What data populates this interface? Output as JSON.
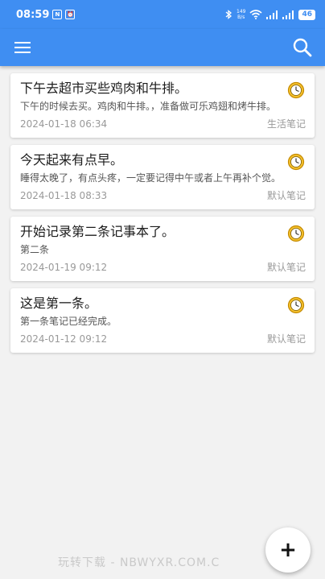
{
  "status_bar": {
    "time": "08:59",
    "network_speed_value": "149",
    "network_speed_unit": "B/s",
    "battery_level": "46",
    "icons": [
      "notification-n-icon",
      "notification-alarm-icon",
      "bluetooth-icon",
      "wifi-icon",
      "signal-icon",
      "signal-icon-2",
      "battery-icon"
    ]
  },
  "app_bar": {
    "menu_icon": "hamburger-menu-icon",
    "search_icon": "search-icon",
    "color": "#3f8ef2"
  },
  "notes": [
    {
      "title": "下午去超市买些鸡肉和牛排。",
      "body": "下午的时候去买。鸡肉和牛排。，准备做可乐鸡翅和烤牛排。",
      "date": "2024-01-18 06:34",
      "category": "生活笔记",
      "icon": "clock-icon"
    },
    {
      "title": "今天起来有点早。",
      "body": "睡得太晚了，有点头疼，一定要记得中午或者上午再补个觉。",
      "date": "2024-01-18 08:33",
      "category": "默认笔记",
      "icon": "clock-icon"
    },
    {
      "title": "开始记录第二条记事本了。",
      "body": "第二条",
      "date": "2024-01-19 09:12",
      "category": "默认笔记",
      "icon": "clock-icon"
    },
    {
      "title": "这是第一条。",
      "body": "第一条笔记已经完成。",
      "date": "2024-01-12 09:12",
      "category": "默认笔记",
      "icon": "clock-icon"
    }
  ],
  "fab": {
    "label": "+"
  },
  "watermark": "玩转下载 - NBWYXR.COM.C"
}
